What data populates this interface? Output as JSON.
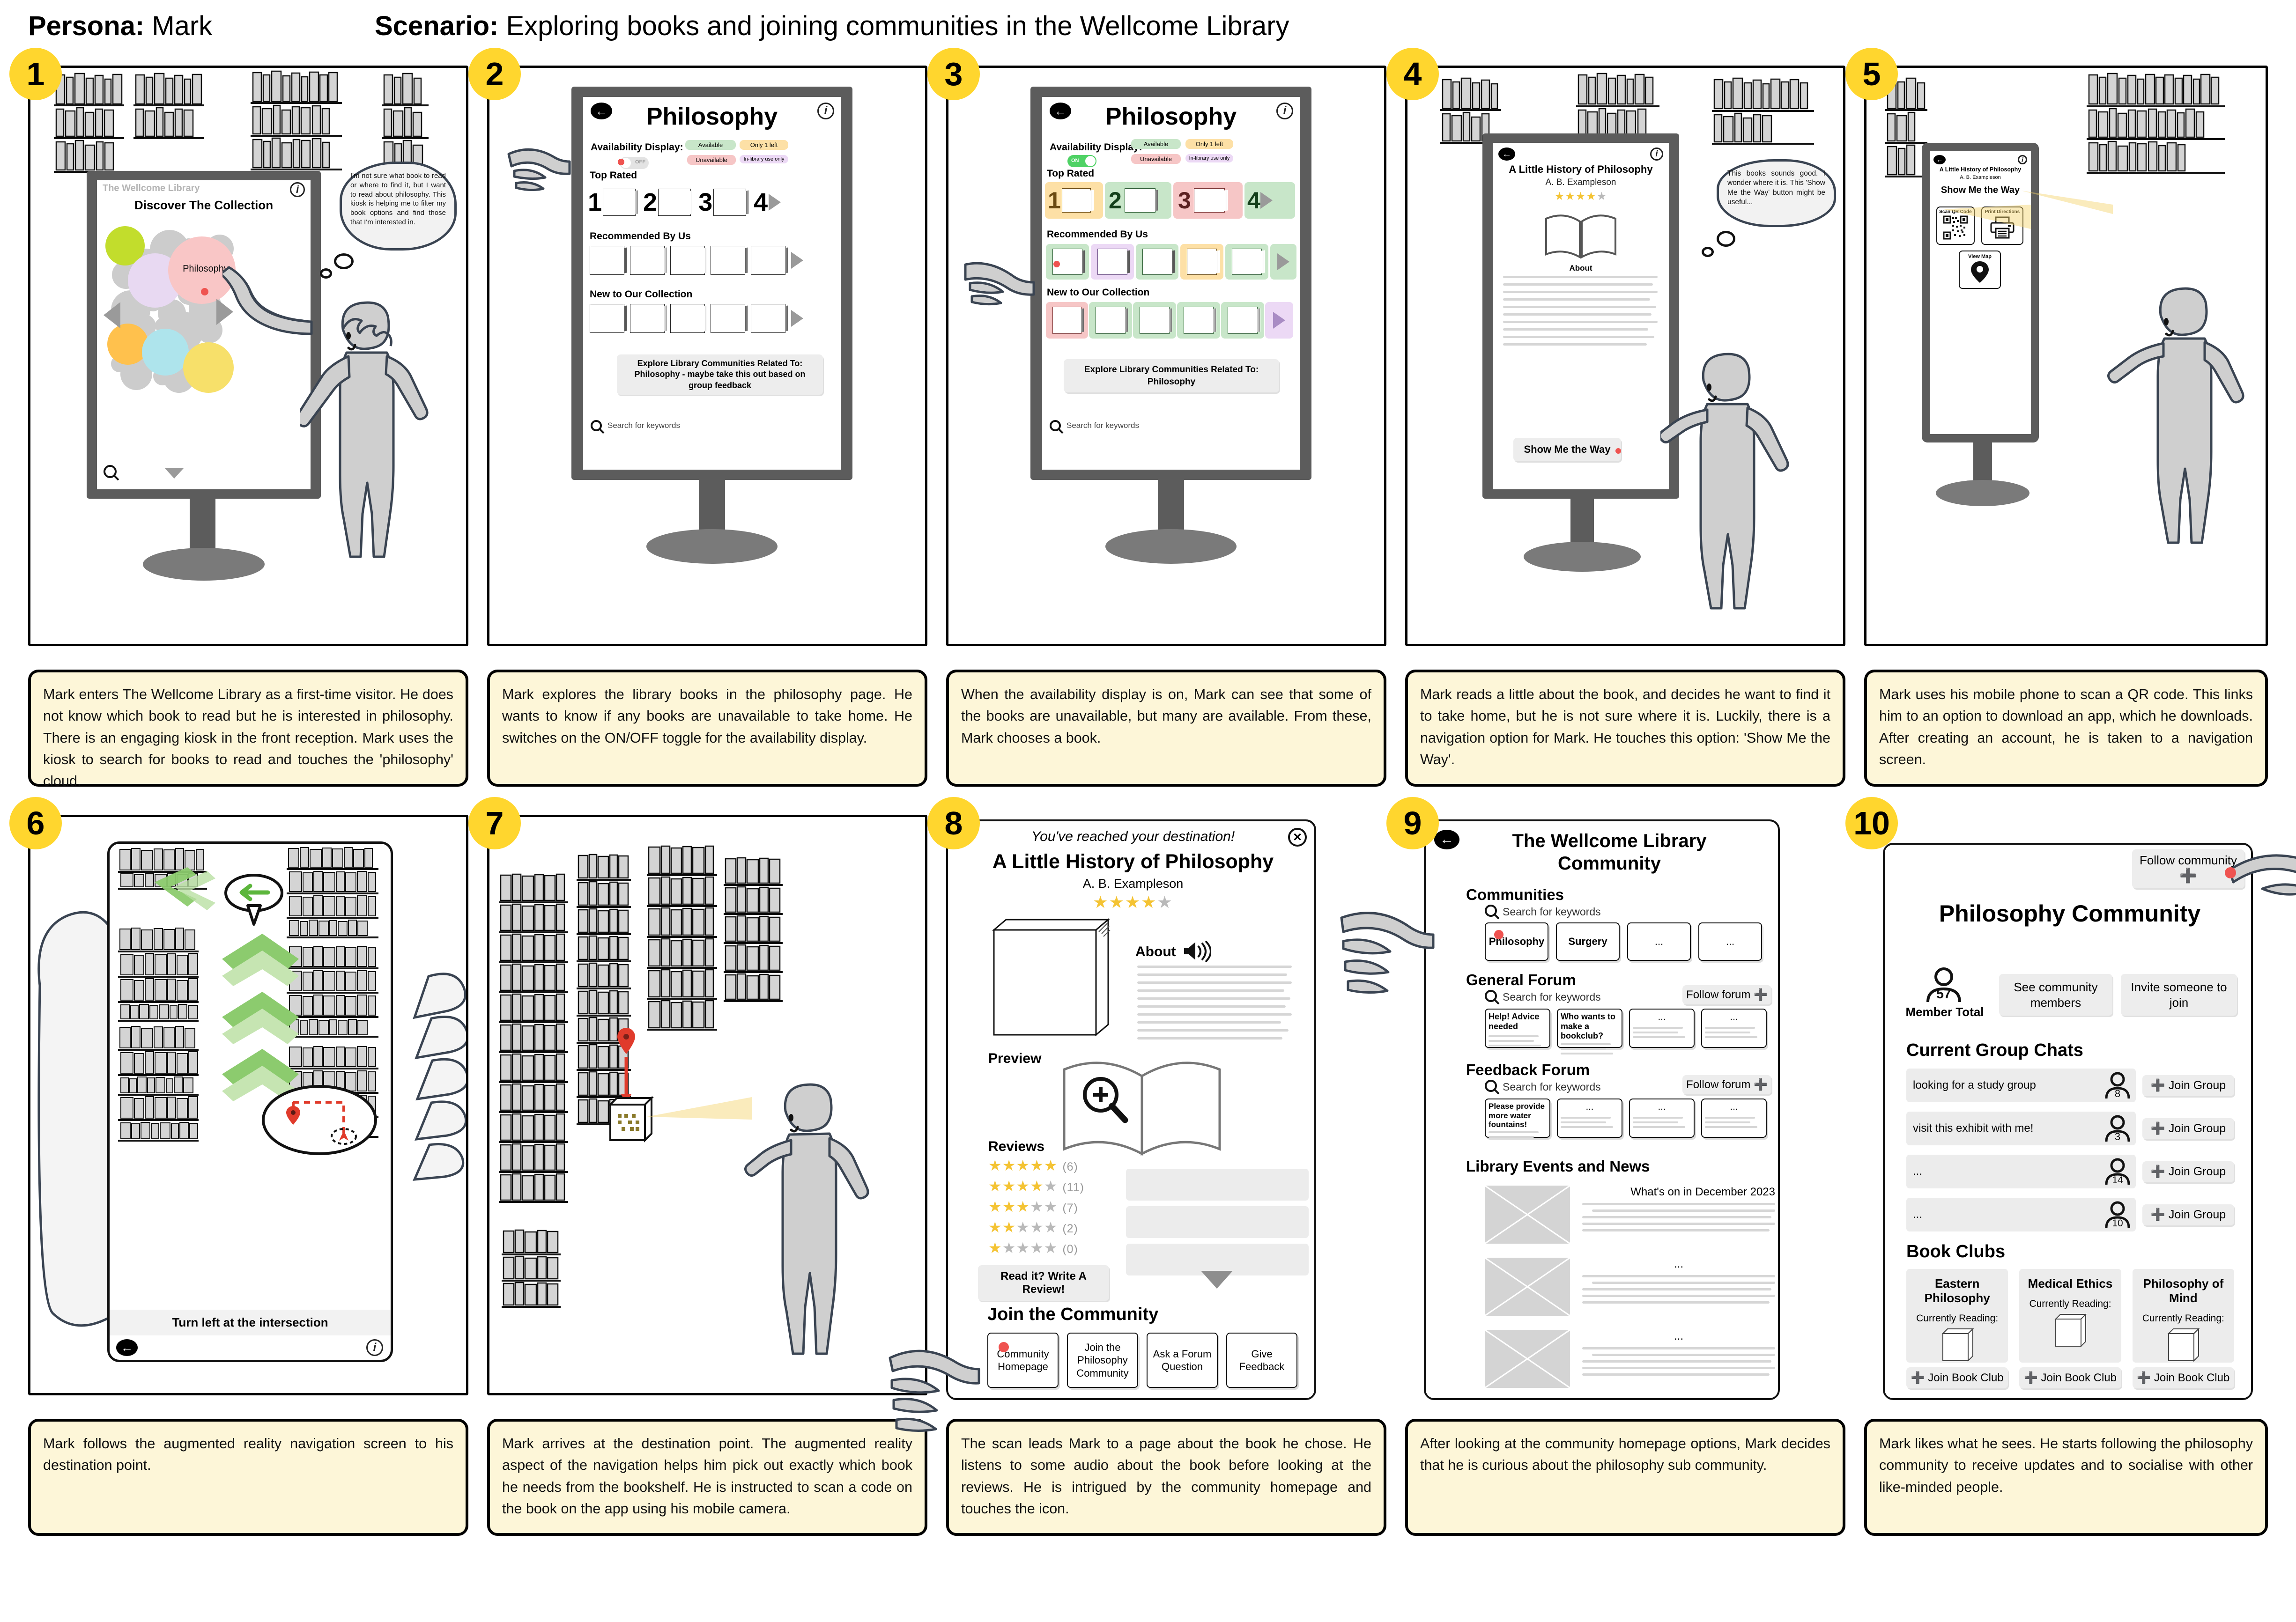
{
  "header": {
    "persona_label": "Persona:",
    "persona_value": "Mark",
    "scenario_label": "Scenario:",
    "scenario_value": "Exploring books and joining communities in the Wellcome Library"
  },
  "common": {
    "back_icon": "arrow-left-icon",
    "info_icon": "info-icon",
    "search_placeholder": "Search for keywords",
    "book_title": "A Little History of Philosophy",
    "book_author": "A. B. Exampleson",
    "rating_filled": 4,
    "rating_total": 5
  },
  "panels": [
    {
      "number": "1",
      "caption": "Mark enters The Wellcome Library as a first-time visitor. He does not know which book to read but he is interested in philosophy. There is an engaging kiosk in the front reception. Mark uses the kiosk to search for books to read and touches the 'philosophy' cloud.",
      "screen": {
        "brand": "The Wellcome Library",
        "title": "Discover The Collection",
        "selected_bubble": "Philosophy",
        "search_icon": "search-icon",
        "prev_icon": "triangle-left-icon",
        "next_icon": "triangle-right-icon",
        "down_icon": "triangle-down-icon",
        "bubble_colors": [
          "#c2dd2c",
          "#e8d9f2",
          "#ffc14d",
          "#aee4ec",
          "#f7e06a",
          "#f9c6c6"
        ]
      },
      "thought": "I'm not sure what book to read or where to find it, but I want to read about philosophy. This kiosk is helping me to filter my book options and find those that I'm interested in."
    },
    {
      "number": "2",
      "caption": "Mark explores the library books in the philosophy page. He wants to know if any books are unavailable to take home. He switches on the ON/OFF toggle for the availability display.",
      "screen": {
        "title": "Philosophy",
        "availability_label": "Availability Display:",
        "toggle_state": "OFF",
        "legend": [
          {
            "label": "Available",
            "color": "#c8e6c9"
          },
          {
            "label": "Only 1 left",
            "color": "#fde0a6"
          },
          {
            "label": "Unavailable",
            "color": "#f6c6c6"
          },
          {
            "label": "In-library use only",
            "color": "#ecd9f5"
          }
        ],
        "sections": [
          {
            "heading": "Top Rated",
            "ranked": true,
            "ranks": [
              "1",
              "2",
              "3",
              "4"
            ]
          },
          {
            "heading": "Recommended By Us",
            "ranked": false
          },
          {
            "heading": "New to Our Collection",
            "ranked": false
          }
        ],
        "explore_banner": "Explore Library Communities Related To: Philosophy - maybe take this out based on group feedback",
        "search_placeholder": "Search for keywords"
      }
    },
    {
      "number": "3",
      "caption": "When the availability display is on, Mark can see that some of the books are unavailable, but many are available. From these, Mark chooses a book.",
      "screen": {
        "title": "Philosophy",
        "availability_label": "Availability Display:",
        "toggle_state": "ON",
        "legend": [
          {
            "label": "Available",
            "color": "#c8e6c9"
          },
          {
            "label": "Only 1 left",
            "color": "#fde0a6"
          },
          {
            "label": "Unavailable",
            "color": "#f6c6c6"
          },
          {
            "label": "In-library use only",
            "color": "#ecd9f5"
          }
        ],
        "top_rated_states": [
          "#fde0a6",
          "#c8e6c9",
          "#f6c6c6",
          "#c8e6c9"
        ],
        "recommended_states": [
          "#c8e6c9",
          "#ecd9f5",
          "#c8e6c9",
          "#fde0a6",
          "#c8e6c9",
          "#c8e6c9"
        ],
        "new_states": [
          "#f6c6c6",
          "#c8e6c9",
          "#c8e6c9",
          "#c8e6c9",
          "#c8e6c9",
          "#ecd9f5"
        ],
        "sections": [
          {
            "heading": "Top Rated",
            "ranks": [
              "1",
              "2",
              "3",
              "4"
            ]
          },
          {
            "heading": "Recommended By Us"
          },
          {
            "heading": "New to Our Collection"
          }
        ],
        "explore_banner": "Explore Library Communities Related To: Philosophy",
        "search_placeholder": "Search for keywords"
      }
    },
    {
      "number": "4",
      "caption": "Mark reads a little about the book, and decides he want to find it to take home, but he is not sure where it is. Luckily, there is a navigation option for Mark. He touches this option: 'Show Me the Way'.",
      "screen": {
        "title": "A Little History of Philosophy",
        "author": "A. B. Exampleson",
        "about_heading": "About",
        "cta": "Show Me the Way"
      },
      "thought": "This books sounds good. I wonder where it is. This 'Show Me the Way' button might be useful..."
    },
    {
      "number": "5",
      "caption": "Mark uses his mobile phone to scan a QR code. This links him to an option to download an app, which he downloads. After creating an account, he is taken to a navigation screen.",
      "screen": {
        "title": "A Little History of Philosophy",
        "author": "A. B. Exampleson",
        "heading": "Show Me the Way",
        "options": [
          {
            "label": "Scan QR Code",
            "icon": "qr-code-icon"
          },
          {
            "label": "Print Directions",
            "icon": "printer-icon"
          },
          {
            "label": "View Map",
            "icon": "map-pin-icon"
          }
        ]
      }
    },
    {
      "number": "6",
      "caption": "Mark follows the augmented reality navigation screen to his destination point.",
      "screen": {
        "instruction": "Turn left at the intersection",
        "turn_icon": "arrow-left-marker-icon",
        "chevron_icon": "chevron-up-icon",
        "minimap_pin_icon": "map-pin-icon",
        "minimap_user_icon": "navigation-arrow-icon",
        "back_icon": "arrow-left-icon",
        "info_icon": "info-icon"
      }
    },
    {
      "number": "7",
      "caption": "Mark arrives at the destination point. The augmented reality aspect of the navigation helps him pick out exactly which book he needs from the bookshelf. He is instructed to scan a code on the book on the app using his mobile camera."
    },
    {
      "number": "8",
      "caption": "The scan leads Mark to a page about the book he chose. He listens to some audio about the book before looking at the reviews. He is intrigued by the community homepage and touches the icon.",
      "screen": {
        "banner": "You've reached your destination!",
        "close_icon": "close-icon",
        "title": "A Little History of Philosophy",
        "author": "A. B. Exampleson",
        "about_heading": "About",
        "audio_icon": "speaker-icon",
        "preview_heading": "Preview",
        "preview_icon": "zoom-in-icon",
        "reviews_heading": "Reviews",
        "review_rows": [
          {
            "stars": 5,
            "count": "(6)"
          },
          {
            "stars": 4,
            "count": "(11)"
          },
          {
            "stars": 3,
            "count": "(7)"
          },
          {
            "stars": 2,
            "count": "(2)"
          },
          {
            "stars": 1,
            "count": "(0)"
          }
        ],
        "write_review": "Read it? Write A Review!",
        "more_icon": "triangle-down-icon",
        "community_heading": "Join the Community",
        "community_buttons": [
          "Community Homepage",
          "Join the Philosophy Community",
          "Ask a Forum Question",
          "Give Feedback"
        ]
      }
    },
    {
      "number": "9",
      "caption": "After looking at the community homepage options, Mark decides that he is curious about the philosophy sub community.",
      "screen": {
        "title": "The Wellcome Library Community",
        "communities_heading": "Communities",
        "search_placeholder": "Search for keywords",
        "community_tiles": [
          "Philosophy",
          "Surgery",
          "...",
          "..."
        ],
        "general_forum_heading": "General Forum",
        "general_forum_follow": "Follow forum",
        "general_forum_posts": [
          "Help! Advice needed",
          "Who wants to make a bookclub?",
          "...",
          "..."
        ],
        "feedback_forum_heading": "Feedback Forum",
        "feedback_forum_follow": "Follow forum",
        "feedback_forum_posts": [
          "Please provide more water fountains!",
          "...",
          "...",
          "..."
        ],
        "events_heading": "Library Events and News",
        "events": [
          "What's on in December 2023",
          "...",
          "..."
        ]
      }
    },
    {
      "number": "10",
      "caption": "Mark likes what he sees. He starts following the philosophy community to receive updates and to socialise with other like-minded people.",
      "screen": {
        "follow_button": "Follow community",
        "follow_icon": "plus-icon",
        "title": "Philosophy Community",
        "member_count": "57",
        "member_label": "Member Total",
        "member_icon": "person-icon",
        "see_members": "See community members",
        "invite": "Invite someone to join",
        "group_chats_heading": "Current Group Chats",
        "group_chats": [
          {
            "name": "looking for a study group",
            "members": "8",
            "action": "Join Group"
          },
          {
            "name": "visit this exhibit with me!",
            "members": "3",
            "action": "Join Group"
          },
          {
            "name": "...",
            "members": "14",
            "action": "Join Group"
          },
          {
            "name": "...",
            "members": "10",
            "action": "Join Group"
          }
        ],
        "book_clubs_heading": "Book Clubs",
        "book_clubs": [
          {
            "name": "Eastern Philosophy",
            "reading_label": "Currently Reading:",
            "action": "Join Book Club"
          },
          {
            "name": "Medical Ethics",
            "reading_label": "Currently Reading:",
            "action": "Join Book Club"
          },
          {
            "name": "Philosophy of Mind",
            "reading_label": "Currently Reading:",
            "action": "Join Book Club"
          }
        ]
      }
    }
  ]
}
